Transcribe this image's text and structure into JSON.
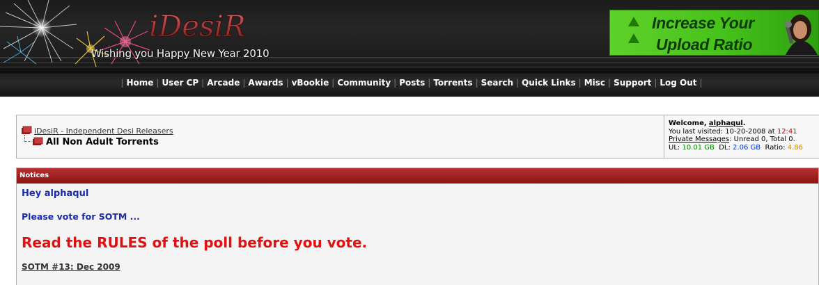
{
  "header": {
    "logo_text": "iDesiR",
    "tagline": "Wishing you Happy New Year 2010",
    "ad": {
      "line1": "Increase Your",
      "line2": "Upload Ratio"
    }
  },
  "nav": {
    "items": [
      "Home",
      "User CP",
      "Arcade",
      "Awards",
      "vBookie",
      "Community",
      "Posts",
      "Torrents",
      "Search",
      "Quick Links",
      "Misc",
      "Support",
      "Log Out"
    ],
    "separator": "|"
  },
  "breadcrumb": {
    "site_link": "iDesiR - Independent Desi Releasers",
    "page_title": "All Non Adult Torrents"
  },
  "welcome": {
    "greeting_label": "Welcome,",
    "username": "alphaqul",
    "last_visited_label": "You last visited:",
    "last_visited_date": "10-20-2008 at",
    "last_visited_time": "12:41",
    "pm_label": "Private Messages",
    "pm_status": ": Unread 0, Total 0.",
    "ul_label": "UL:",
    "ul_value": "10.01 GB",
    "dl_label": "DL:",
    "dl_value": "2.06 GB",
    "ratio_label": "Ratio:",
    "ratio_value": "4.86"
  },
  "notices": {
    "title": "Notices",
    "greeting": "Hey alphaqul",
    "vote": "Please vote for SOTM ...",
    "rules_prefix": "Read the ",
    "rules_keyword": "RULES",
    "rules_suffix": " of the poll before you vote.",
    "sotm_link": "SOTM #13: Dec 2009"
  },
  "colors": {
    "notices_header": "#9c1e1e",
    "notice_blue": "#1a2aa8",
    "notice_red": "#e21010",
    "ad_green": "#46c21a"
  }
}
